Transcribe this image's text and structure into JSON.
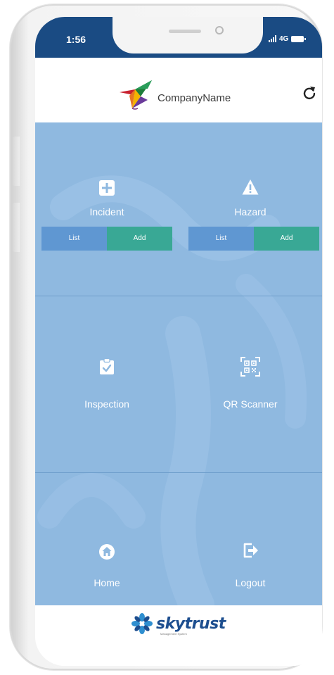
{
  "status_bar": {
    "time": "1:56",
    "network": "4G"
  },
  "header": {
    "company_name": "CompanyName",
    "refresh_icon": "refresh-icon"
  },
  "tiles": {
    "incident": {
      "label": "Incident",
      "icon": "plus-square-icon",
      "list_label": "List",
      "add_label": "Add"
    },
    "hazard": {
      "label": "Hazard",
      "icon": "warning-triangle-icon",
      "list_label": "List",
      "add_label": "Add"
    },
    "inspection": {
      "label": "Inspection",
      "icon": "clipboard-check-icon"
    },
    "qr_scanner": {
      "label": "QR Scanner",
      "icon": "qr-code-icon"
    },
    "home": {
      "label": "Home",
      "icon": "home-icon"
    },
    "logout": {
      "label": "Logout",
      "icon": "logout-icon"
    }
  },
  "footer": {
    "brand": "skytrust",
    "tagline": "Management System"
  },
  "colors": {
    "status_bar": "#1a4b83",
    "grid_bg": "#8fb9e0",
    "list_button": "#5f97d2",
    "add_button": "#39a895",
    "brand": "#1d4e8f"
  }
}
